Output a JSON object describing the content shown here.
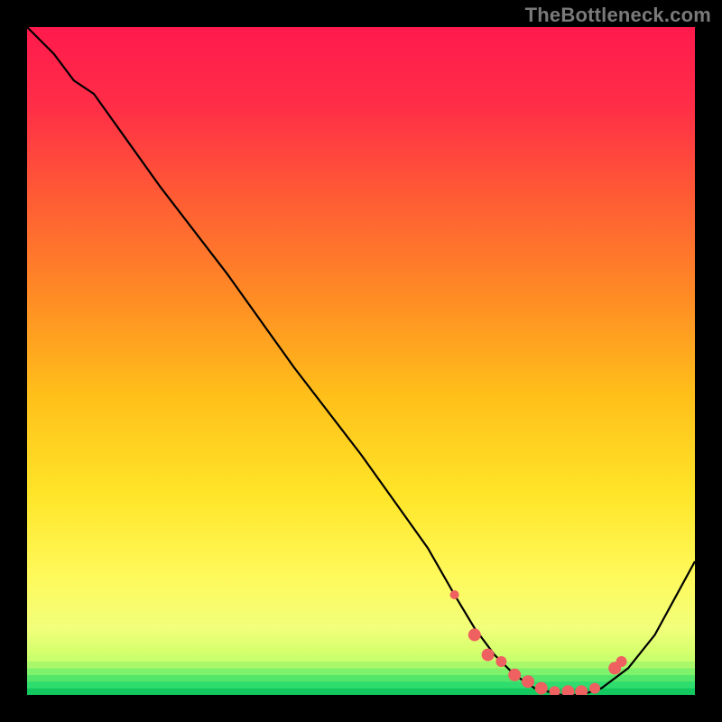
{
  "attribution": "TheBottleneck.com",
  "colors": {
    "gradient_stops": [
      {
        "offset": 0.0,
        "color": "#ff1a4d"
      },
      {
        "offset": 0.12,
        "color": "#ff2e47"
      },
      {
        "offset": 0.25,
        "color": "#ff5a35"
      },
      {
        "offset": 0.4,
        "color": "#ff8a25"
      },
      {
        "offset": 0.55,
        "color": "#ffbf1a"
      },
      {
        "offset": 0.7,
        "color": "#ffe528"
      },
      {
        "offset": 0.82,
        "color": "#fff95a"
      },
      {
        "offset": 0.9,
        "color": "#f2ff7a"
      },
      {
        "offset": 0.955,
        "color": "#c5ff66"
      },
      {
        "offset": 0.975,
        "color": "#7ef26a"
      },
      {
        "offset": 0.99,
        "color": "#2fdc6e"
      },
      {
        "offset": 1.0,
        "color": "#13c95f"
      }
    ],
    "curve": "#000000",
    "marker_fill": "#ef6060",
    "marker_stroke": "#b24444"
  },
  "chart_data": {
    "type": "line",
    "title": "",
    "xlabel": "",
    "ylabel": "",
    "xlim": [
      0,
      100
    ],
    "ylim": [
      0,
      100
    ],
    "series": [
      {
        "name": "bottleneck-curve",
        "x": [
          0,
          4,
          7,
          10,
          15,
          20,
          30,
          40,
          50,
          55,
          60,
          64,
          67,
          70,
          73,
          76,
          80,
          83,
          86,
          90,
          94,
          100
        ],
        "y": [
          100,
          96,
          92,
          90,
          83,
          76,
          63,
          49,
          36,
          29,
          22,
          15,
          10,
          6,
          3,
          1,
          0,
          0,
          1,
          4,
          9,
          20
        ]
      }
    ],
    "markers": {
      "name": "sample-points",
      "x": [
        64,
        67,
        69,
        71,
        73,
        75,
        77,
        79,
        81,
        83,
        85,
        88,
        89
      ],
      "y": [
        15,
        9,
        6,
        5,
        3,
        2,
        1,
        0.5,
        0.5,
        0.5,
        1,
        4,
        5
      ],
      "size": [
        5,
        7,
        7,
        6,
        7,
        7,
        7,
        6,
        7,
        7,
        6,
        7,
        6
      ]
    },
    "green_band": {
      "y_start": 0,
      "y_end": 6,
      "stripes": [
        "#13c95f",
        "#2fdc6e",
        "#54e66a",
        "#7ef26a",
        "#a9f86b",
        "#caff6e"
      ]
    }
  }
}
